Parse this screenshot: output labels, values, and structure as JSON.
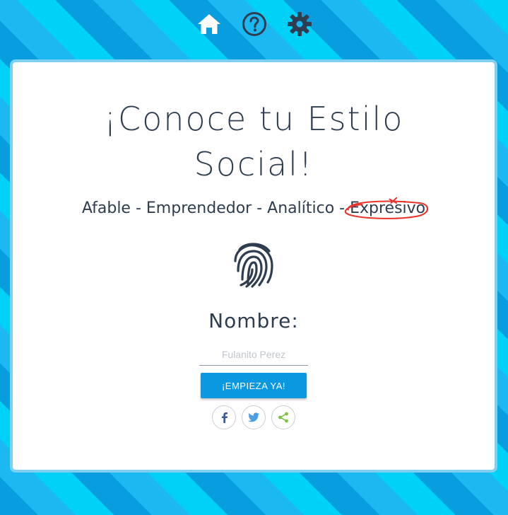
{
  "nav": {
    "home_icon": "home-icon",
    "help_icon": "help-icon",
    "settings_icon": "gear-icon",
    "icon_color": "#ffffff",
    "help_color": "#2e3d4f",
    "settings_color": "#2e3d4f"
  },
  "hero": {
    "title": "¡Conoce tu Estilo Social!",
    "styles": {
      "s1": "Afable",
      "s2": "Emprendedor",
      "s3": "Analítico",
      "s4": "Expresivo",
      "sep": " - "
    },
    "highlight_color": "#e8322b",
    "fingerprint_icon": "fingerprint-icon"
  },
  "form": {
    "name_label": "Nombre:",
    "name_placeholder": "Fulanito Perez",
    "name_value": "",
    "start_label": "¡EMPIEZA YA!",
    "button_color": "#0a98e0"
  },
  "share": {
    "facebook_icon": "facebook-icon",
    "twitter_icon": "twitter-icon",
    "share_icon": "share-icon",
    "facebook_color": "#3b5998",
    "twitter_color": "#4a9fe0",
    "share_color": "#7dc242"
  },
  "colors": {
    "text": "#2e3d4f",
    "card_border": "#7fd0ef",
    "bg_dark": "#079ddf",
    "bg_light": "#00d2f7"
  }
}
